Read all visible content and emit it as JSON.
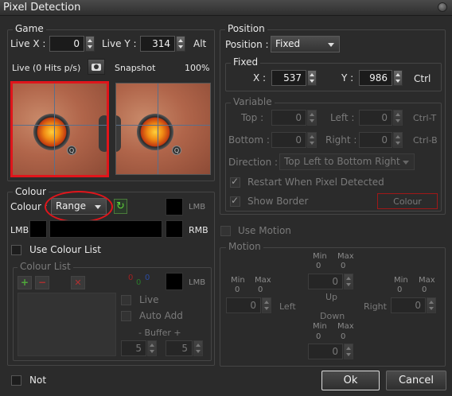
{
  "window": {
    "title": "Pixel Detection"
  },
  "game": {
    "group_label": "Game",
    "live_x_label": "Live X :",
    "live_x": "0",
    "live_y_label": "Live Y :",
    "live_y": "314",
    "alt_label": "Alt",
    "live_status": "Live (0 Hits p/s)",
    "snapshot_label": "Snapshot",
    "zoom": "100%"
  },
  "colour": {
    "group_label": "Colour",
    "colour_label": "Colour :",
    "mode": "Range",
    "lmb_tag": "LMB",
    "lmb_label": "LMB",
    "rmb_label": "RMB",
    "use_colour_list": "Use Colour List",
    "list_group_label": "Colour List",
    "rgb_r": "0",
    "rgb_g": "0",
    "rgb_b": "0",
    "list_lmb": "LMB",
    "live": "Live",
    "auto_add": "Auto Add",
    "buffer_label": "-  Buffer  +",
    "buffer_minus": "5",
    "buffer_plus": "5",
    "not_label": "Not"
  },
  "position": {
    "group_label": "Position",
    "position_label": "Position :",
    "position_mode": "Fixed",
    "fixed_label": "Fixed",
    "x_label": "X :",
    "x": "537",
    "y_label": "Y :",
    "y": "986",
    "ctrl_label": "Ctrl",
    "variable_label": "Variable",
    "top_label": "Top :",
    "top": "0",
    "left_label": "Left :",
    "left": "0",
    "ctrl_t": "Ctrl-T",
    "bottom_label": "Bottom :",
    "bottom": "0",
    "right_label": "Right :",
    "right": "0",
    "ctrl_b": "Ctrl-B",
    "direction_label": "Direction :",
    "direction": "Top Left to Bottom Right",
    "restart": "Restart When Pixel Detected",
    "show_border": "Show Border",
    "colour_button": "Colour"
  },
  "motion": {
    "use_motion": "Use Motion",
    "group_label": "Motion",
    "min": "Min",
    "max": "Max",
    "zero": "0",
    "up": "Up",
    "left": "Left",
    "right": "Right",
    "down": "Down",
    "up_value": "0",
    "left_value": "0",
    "right_value": "0",
    "down_value": "0"
  },
  "buttons": {
    "ok": "Ok",
    "cancel": "Cancel"
  },
  "colors": {
    "highlight": "#e0151b",
    "background": "#2b2b2b",
    "border": "#454545"
  }
}
